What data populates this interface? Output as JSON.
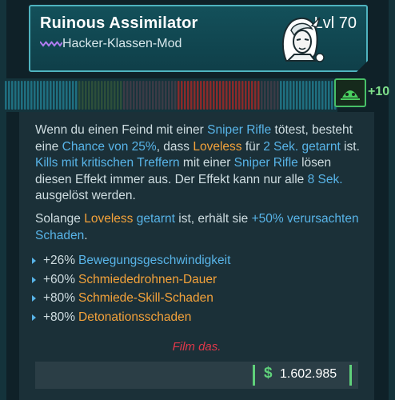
{
  "item": {
    "name": "Ruinous Assimilator",
    "level": "Lvl 70",
    "type": "Hacker-Klassen-Mod",
    "rarity_icon": "purple-chevrons-icon",
    "portrait_icon": "hacker-portrait-icon"
  },
  "anoint": {
    "icon": "green-skull-icon",
    "tag": "+10"
  },
  "description": {
    "p1": [
      {
        "text": "Wenn du einen Feind mit einer ",
        "style": ""
      },
      {
        "text": "Sniper Rifle",
        "style": "b"
      },
      {
        "text": " tötest, besteht eine ",
        "style": ""
      },
      {
        "text": "Chance von 25%",
        "style": "b"
      },
      {
        "text": ", dass ",
        "style": ""
      },
      {
        "text": "Loveless",
        "style": "o"
      },
      {
        "text": " für ",
        "style": ""
      },
      {
        "text": "2 Sek. getarnt",
        "style": "b"
      },
      {
        "text": " ist. ",
        "style": ""
      },
      {
        "text": "Kills mit kritischen Treffern",
        "style": "b"
      },
      {
        "text": " mit einer ",
        "style": ""
      },
      {
        "text": "Sniper Rifle",
        "style": "b"
      },
      {
        "text": " lösen diesen Effekt immer aus. Der Effekt kann nur alle ",
        "style": ""
      },
      {
        "text": "8 Sek.",
        "style": "b"
      },
      {
        "text": " ausgelöst werden.",
        "style": ""
      }
    ],
    "p2": [
      {
        "text": "Solange ",
        "style": ""
      },
      {
        "text": "Loveless",
        "style": "o"
      },
      {
        "text": " ",
        "style": ""
      },
      {
        "text": "getarnt",
        "style": "b"
      },
      {
        "text": " ist, erhält sie ",
        "style": ""
      },
      {
        "text": "+50% verursachten Schaden",
        "style": "b"
      },
      {
        "text": ".",
        "style": ""
      }
    ]
  },
  "stats": [
    {
      "value": "+26%",
      "label": "Bewegungsgeschwindigkeit",
      "color": "#58b4e8"
    },
    {
      "value": "+60%",
      "label": "Schmiededrohnen-Dauer",
      "color": "#f4a23a"
    },
    {
      "value": "+80%",
      "label": "Schmiede-Skill-Schaden",
      "color": "#f4a23a"
    },
    {
      "value": "+80%",
      "label": "Detonationsschaden",
      "color": "#f4a23a"
    }
  ],
  "flavor": "Film das.",
  "price": {
    "symbol": "$",
    "value": "1.602.985"
  },
  "colors": {
    "accent": "#4fb3bf",
    "skill_blue": "#58b4e8",
    "skill_orange": "#f4a23a",
    "flavor_red": "#e0384a",
    "money_green": "#5fd17a"
  }
}
